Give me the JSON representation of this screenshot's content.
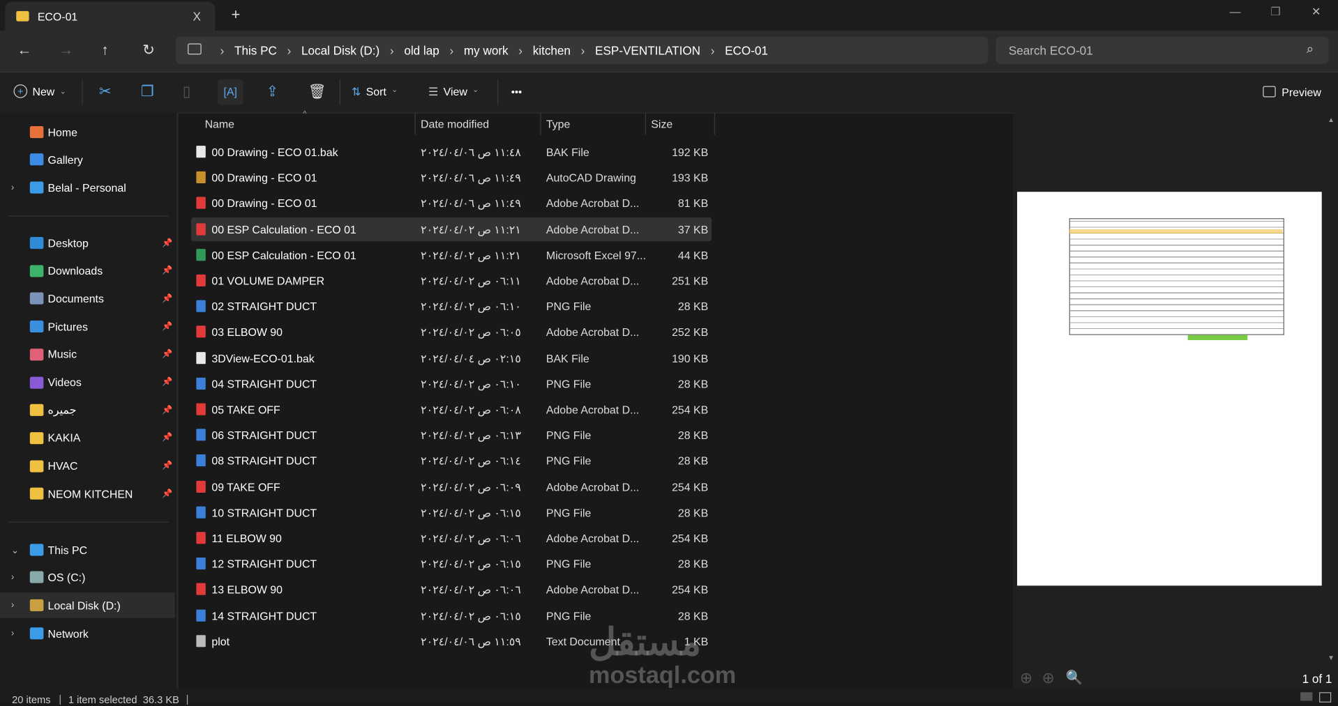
{
  "window": {
    "tab_title": "ECO-01",
    "new_tab": "+",
    "close_tab": "X",
    "minimize": "—",
    "restore": "❐",
    "close": "✕"
  },
  "address": {
    "crumbs": [
      "This PC",
      "Local Disk (D:)",
      "old lap",
      "my work",
      "kitchen",
      "ESP-VENTILATION",
      "ECO-01"
    ],
    "search_placeholder": "Search ECO-01"
  },
  "toolbar": {
    "new_label": "New",
    "sort_label": "Sort",
    "view_label": "View",
    "more": "•••",
    "preview_label": "Preview"
  },
  "sidebar": {
    "top": [
      {
        "label": "Home",
        "color": "#e8703a"
      },
      {
        "label": "Gallery",
        "color": "#3c8ce6"
      },
      {
        "label": "Belal - Personal",
        "color": "#3a9be8",
        "expand": true
      }
    ],
    "pinned": [
      {
        "label": "Desktop",
        "color": "#2f8ad8"
      },
      {
        "label": "Downloads",
        "color": "#3bb36b"
      },
      {
        "label": "Documents",
        "color": "#7b93b8"
      },
      {
        "label": "Pictures",
        "color": "#3a8fe0"
      },
      {
        "label": "Music",
        "color": "#e0607a"
      },
      {
        "label": "Videos",
        "color": "#8a5ad8"
      },
      {
        "label": "جميره",
        "color": "#f0c040"
      },
      {
        "label": "KAKIA",
        "color": "#f0c040"
      },
      {
        "label": "HVAC",
        "color": "#f0c040"
      },
      {
        "label": "NEOM KITCHEN",
        "color": "#f0c040"
      }
    ],
    "tree": [
      {
        "label": "This PC",
        "color": "#3a9be8",
        "chev": "⌄"
      },
      {
        "label": "OS (C:)",
        "color": "#8aa",
        "chev": "›"
      },
      {
        "label": "Local Disk (D:)",
        "color": "#c9a040",
        "chev": "›"
      },
      {
        "label": "Network",
        "color": "#3a9be8",
        "chev": "›"
      }
    ]
  },
  "columns": {
    "name": "Name",
    "date": "Date modified",
    "type": "Type",
    "size": "Size"
  },
  "files": [
    {
      "name": "00 Drawing - ECO 01.bak",
      "date": "٢٠٢٤/٠٤/٠٦ ص ١١:٤٨",
      "type": "BAK File",
      "size": "192 KB",
      "icon": "bak"
    },
    {
      "name": "00 Drawing - ECO 01",
      "date": "٢٠٢٤/٠٤/٠٦ ص ١١:٤٩",
      "type": "AutoCAD Drawing",
      "size": "193 KB",
      "icon": "dwg"
    },
    {
      "name": "00 Drawing - ECO 01",
      "date": "٢٠٢٤/٠٤/٠٦ ص ١١:٤٩",
      "type": "Adobe Acrobat D...",
      "size": "81 KB",
      "icon": "pdf"
    },
    {
      "name": "00 ESP Calculation - ECO 01",
      "date": "٢٠٢٤/٠٤/٠٢ ص ١١:٢١",
      "type": "Adobe Acrobat D...",
      "size": "37 KB",
      "icon": "pdf",
      "selected": true
    },
    {
      "name": "00 ESP Calculation - ECO 01",
      "date": "٢٠٢٤/٠٤/٠٢ ص ١١:٢١",
      "type": "Microsoft Excel 97...",
      "size": "44 KB",
      "icon": "xls"
    },
    {
      "name": "01 VOLUME DAMPER",
      "date": "٢٠٢٤/٠٤/٠٢ ص ٠٦:١١",
      "type": "Adobe Acrobat D...",
      "size": "251 KB",
      "icon": "pdf"
    },
    {
      "name": "02 STRAIGHT DUCT",
      "date": "٢٠٢٤/٠٤/٠٢ ص ٠٦:١٠",
      "type": "PNG File",
      "size": "28 KB",
      "icon": "png"
    },
    {
      "name": "03 ELBOW 90",
      "date": "٢٠٢٤/٠٤/٠٢ ص ٠٦:٠٥",
      "type": "Adobe Acrobat D...",
      "size": "252 KB",
      "icon": "pdf"
    },
    {
      "name": "3DView-ECO-01.bak",
      "date": "٢٠٢٤/٠٤/٠٤ ص ٠٢:١٥",
      "type": "BAK File",
      "size": "190 KB",
      "icon": "bak"
    },
    {
      "name": "04 STRAIGHT DUCT",
      "date": "٢٠٢٤/٠٤/٠٢ ص ٠٦:١٠",
      "type": "PNG File",
      "size": "28 KB",
      "icon": "png"
    },
    {
      "name": "05 TAKE OFF",
      "date": "٢٠٢٤/٠٤/٠٢ ص ٠٦:٠٨",
      "type": "Adobe Acrobat D...",
      "size": "254 KB",
      "icon": "pdf"
    },
    {
      "name": "06 STRAIGHT DUCT",
      "date": "٢٠٢٤/٠٤/٠٢ ص ٠٦:١٣",
      "type": "PNG File",
      "size": "28 KB",
      "icon": "png"
    },
    {
      "name": "08 STRAIGHT DUCT",
      "date": "٢٠٢٤/٠٤/٠٢ ص ٠٦:١٤",
      "type": "PNG File",
      "size": "28 KB",
      "icon": "png"
    },
    {
      "name": "09 TAKE OFF",
      "date": "٢٠٢٤/٠٤/٠٢ ص ٠٦:٠٩",
      "type": "Adobe Acrobat D...",
      "size": "254 KB",
      "icon": "pdf"
    },
    {
      "name": "10 STRAIGHT DUCT",
      "date": "٢٠٢٤/٠٤/٠٢ ص ٠٦:١٥",
      "type": "PNG File",
      "size": "28 KB",
      "icon": "png"
    },
    {
      "name": "11 ELBOW 90",
      "date": "٢٠٢٤/٠٤/٠٢ ص ٠٦:٠٦",
      "type": "Adobe Acrobat D...",
      "size": "254 KB",
      "icon": "pdf"
    },
    {
      "name": "12 STRAIGHT DUCT",
      "date": "٢٠٢٤/٠٤/٠٢ ص ٠٦:١٥",
      "type": "PNG File",
      "size": "28 KB",
      "icon": "png"
    },
    {
      "name": "13 ELBOW 90",
      "date": "٢٠٢٤/٠٤/٠٢ ص ٠٦:٠٦",
      "type": "Adobe Acrobat D...",
      "size": "254 KB",
      "icon": "pdf"
    },
    {
      "name": "14 STRAIGHT DUCT",
      "date": "٢٠٢٤/٠٤/٠٢ ص ٠٦:١٥",
      "type": "PNG File",
      "size": "28 KB",
      "icon": "png"
    },
    {
      "name": "plot",
      "date": "٢٠٢٤/٠٤/٠٦ ص ١١:٥٩",
      "type": "Text Document",
      "size": "1 KB",
      "icon": "txt"
    }
  ],
  "icon_colors": {
    "bak": "#e8e8e8",
    "dwg": "#c8902a",
    "pdf": "#e03a3a",
    "xls": "#2f9a58",
    "png": "#3a7fd8",
    "txt": "#bbbbbb"
  },
  "preview": {
    "page_count": "1 of 1"
  },
  "status": {
    "items": "20 items",
    "selected": "1 item selected  36.3 KB"
  },
  "watermark": "mostaql.com"
}
